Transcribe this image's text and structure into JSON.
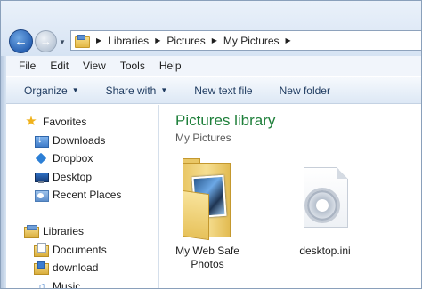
{
  "address": {
    "crumbs": [
      "Libraries",
      "Pictures",
      "My Pictures"
    ]
  },
  "menu": {
    "items": [
      "File",
      "Edit",
      "View",
      "Tools",
      "Help"
    ]
  },
  "commands": {
    "organize": "Organize",
    "share_with": "Share with",
    "new_text_file": "New text file",
    "new_folder": "New folder"
  },
  "nav": {
    "favorites": "Favorites",
    "downloads": "Downloads",
    "dropbox": "Dropbox",
    "desktop": "Desktop",
    "recent_places": "Recent Places",
    "libraries": "Libraries",
    "documents": "Documents",
    "download": "download",
    "music": "Music"
  },
  "content": {
    "title": "Pictures library",
    "subtitle": "My Pictures",
    "files": [
      {
        "name_line1": "My Web Safe",
        "name_line2": "Photos",
        "icon": "folder-with-photo-icon"
      },
      {
        "name_line1": "desktop.ini",
        "icon": "settings-file-icon"
      }
    ]
  },
  "colors": {
    "title_green": "#1e7f3a",
    "command_text": "#1e3a5f",
    "star": "#f0b21c"
  }
}
